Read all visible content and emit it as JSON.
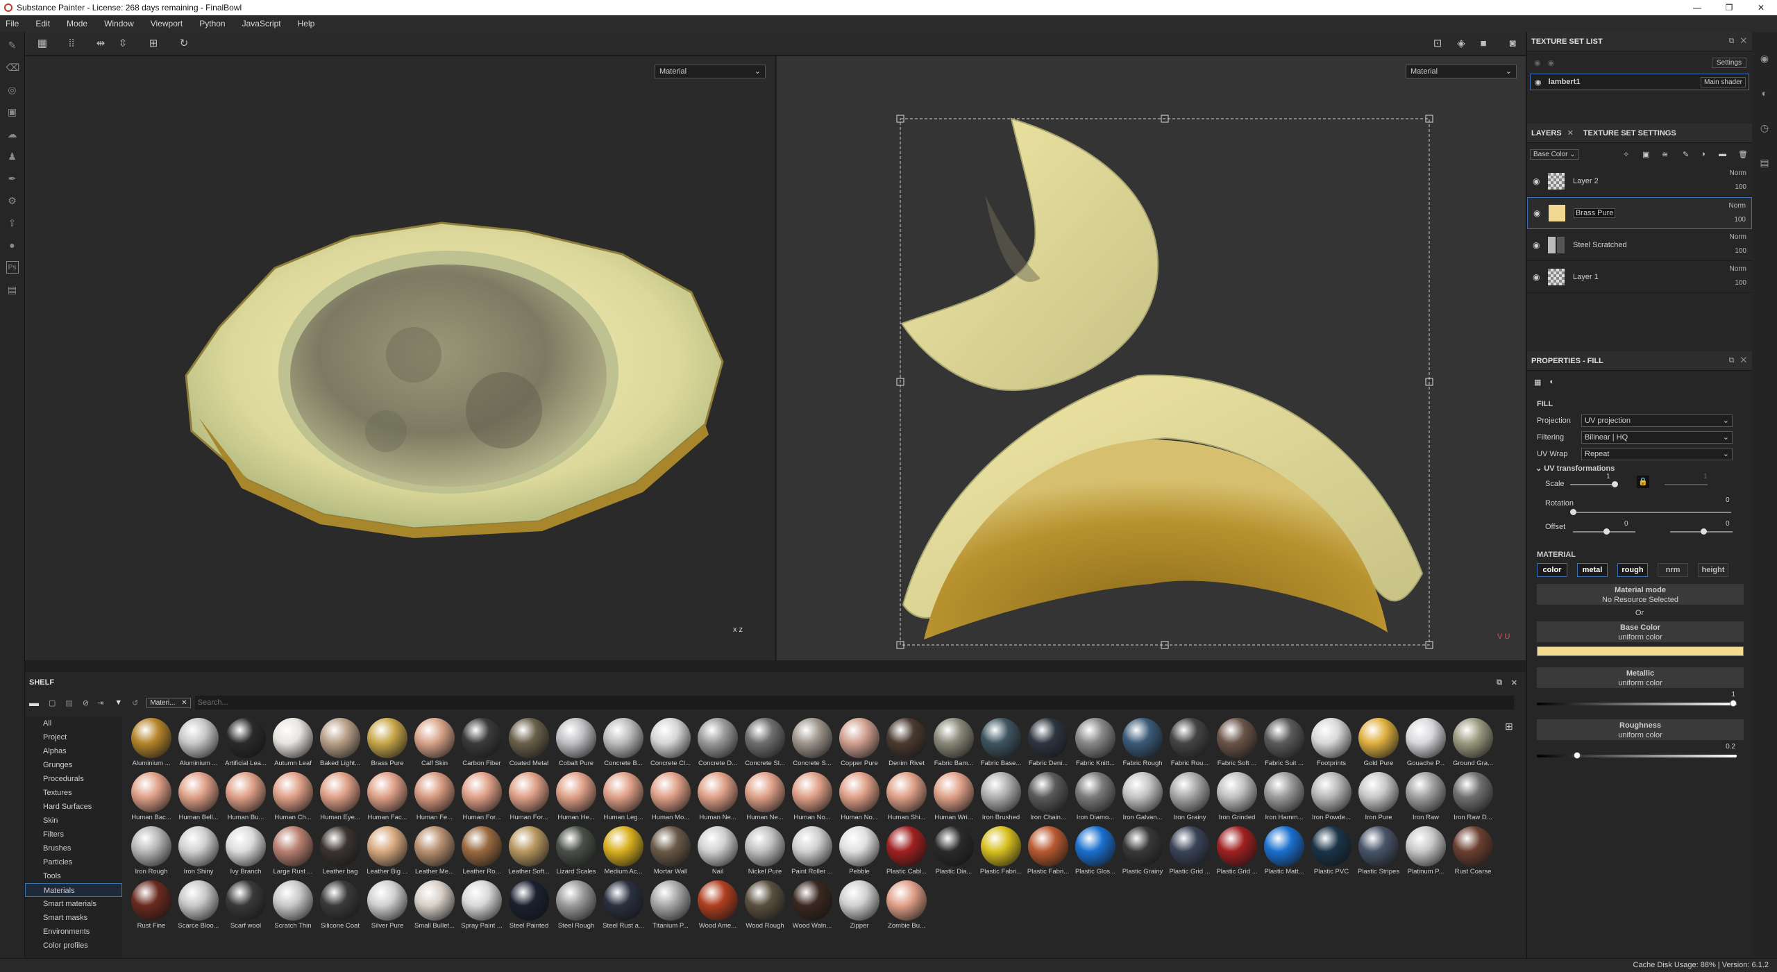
{
  "window": {
    "title": "Substance Painter - License: 268 days remaining - FinalBowl",
    "controls": [
      "—",
      "❐",
      "✕"
    ]
  },
  "menu": [
    "File",
    "Edit",
    "Mode",
    "Window",
    "Viewport",
    "Python",
    "JavaScript",
    "Help"
  ],
  "viewport": {
    "left_mode": "Material",
    "right_mode": "Material",
    "axis_left": "x z",
    "axis_right": "V U"
  },
  "texture_set_list": {
    "title": "TEXTURE SET LIST",
    "settings_label": "Settings",
    "item_name": "lambert1",
    "shader_label": "Main shader"
  },
  "layers_panel": {
    "tab_layers": "LAYERS",
    "tab_settings": "TEXTURE SET SETTINGS",
    "channel": "Base Color",
    "layers": [
      {
        "name": "Layer 2",
        "blend": "Norm",
        "opacity": "100",
        "selected": false,
        "thumb": "checker"
      },
      {
        "name": "Brass Pure",
        "blend": "Norm",
        "opacity": "100",
        "selected": true,
        "thumb": "#f1d891"
      },
      {
        "name": "Steel Scratched",
        "blend": "Norm",
        "opacity": "100",
        "selected": false,
        "thumb": "folder"
      },
      {
        "name": "Layer 1",
        "blend": "Norm",
        "opacity": "100",
        "selected": false,
        "thumb": "checker"
      }
    ]
  },
  "properties": {
    "title": "PROPERTIES - FILL",
    "fill_label": "FILL",
    "projection_label": "Projection",
    "projection_value": "UV projection",
    "filtering_label": "Filtering",
    "filtering_value": "Bilinear | HQ",
    "uvwrap_label": "UV Wrap",
    "uvwrap_value": "Repeat",
    "uv_transform_label": "UV transformations",
    "scale_label": "Scale",
    "scale_value": "1",
    "scale_value2": "1",
    "rotation_label": "Rotation",
    "rotation_value": "0",
    "offset_label": "Offset",
    "offset_value1": "0",
    "offset_value2": "0",
    "material_label": "MATERIAL",
    "material_buttons": [
      {
        "label": "color",
        "on": true
      },
      {
        "label": "metal",
        "on": true
      },
      {
        "label": "rough",
        "on": true
      },
      {
        "label": "nrm",
        "on": false
      },
      {
        "label": "height",
        "on": false
      }
    ],
    "material_mode_title": "Material mode",
    "material_mode_sub": "No Resource Selected",
    "or_label": "Or",
    "base_color_title": "Base Color",
    "base_color_sub": "uniform color",
    "base_color_hex": "#f3dc8f",
    "metallic_title": "Metallic",
    "metallic_sub": "uniform color",
    "metallic_value": "1",
    "metallic_level": 1.0,
    "roughness_title": "Roughness",
    "roughness_sub": "uniform color",
    "roughness_value": "0.2",
    "roughness_level": 0.2
  },
  "shelf": {
    "title": "SHELF",
    "filter_tag": "Materi...",
    "search_placeholder": "Search...",
    "categories": [
      "All",
      "Project",
      "Alphas",
      "Grunges",
      "Procedurals",
      "Textures",
      "Hard Surfaces",
      "Skin",
      "Filters",
      "Brushes",
      "Particles",
      "Tools",
      "Materials",
      "Smart materials",
      "Smart masks",
      "Environments",
      "Color profiles"
    ],
    "selected_category": "Materials",
    "materials": [
      {
        "name": "Aluminium ...",
        "color": "#b5852a"
      },
      {
        "name": "Aluminium ...",
        "color": "#c8c8c8"
      },
      {
        "name": "Artificial Lea...",
        "color": "#2a2a2a"
      },
      {
        "name": "Autumn Leaf",
        "color": "#e8e4e0"
      },
      {
        "name": "Baked Light...",
        "color": "#b8a088"
      },
      {
        "name": "Brass Pure",
        "color": "#c9a84a"
      },
      {
        "name": "Calf Skin",
        "color": "#d8a48a"
      },
      {
        "name": "Carbon Fiber",
        "color": "#3a3a3a"
      },
      {
        "name": "Coated Metal",
        "color": "#6a604a"
      },
      {
        "name": "Cobalt Pure",
        "color": "#c0c0c4"
      },
      {
        "name": "Concrete B...",
        "color": "#bdbdbd"
      },
      {
        "name": "Concrete Cl...",
        "color": "#d6d6d6"
      },
      {
        "name": "Concrete D...",
        "color": "#9a9a9a"
      },
      {
        "name": "Concrete Sl...",
        "color": "#6e6e6e"
      },
      {
        "name": "Concrete S...",
        "color": "#9e968c"
      },
      {
        "name": "Copper Pure",
        "color": "#d0a090"
      },
      {
        "name": "Denim Rivet",
        "color": "#4a3a30"
      },
      {
        "name": "Fabric Bam...",
        "color": "#8a8878"
      },
      {
        "name": "Fabric Base...",
        "color": "#3e5560"
      },
      {
        "name": "Fabric Deni...",
        "color": "#2e3540"
      },
      {
        "name": "Fabric Knitt...",
        "color": "#888888"
      },
      {
        "name": "Fabric Rough",
        "color": "#3a5a78"
      },
      {
        "name": "Fabric Rou...",
        "color": "#444444"
      },
      {
        "name": "Fabric Soft ...",
        "color": "#6a5448"
      },
      {
        "name": "Fabric Suit ...",
        "color": "#5a5a5a"
      },
      {
        "name": "Footprints",
        "color": "#d8d8d8"
      },
      {
        "name": "Gold Pure",
        "color": "#e0b040"
      },
      {
        "name": "Gouache P...",
        "color": "#d8d8dc"
      },
      {
        "name": "Ground Gra...",
        "color": "#9a9a80"
      },
      {
        "name": "Human Bac...",
        "color": "#e0a088"
      },
      {
        "name": "Human Bell...",
        "color": "#e0a088"
      },
      {
        "name": "Human Bu...",
        "color": "#e0a088"
      },
      {
        "name": "Human Ch...",
        "color": "#e0a088"
      },
      {
        "name": "Human Eye...",
        "color": "#e0a088"
      },
      {
        "name": "Human Fac...",
        "color": "#e0a088"
      },
      {
        "name": "Human Fe...",
        "color": "#d89a80"
      },
      {
        "name": "Human For...",
        "color": "#e0a088"
      },
      {
        "name": "Human For...",
        "color": "#e0a088"
      },
      {
        "name": "Human He...",
        "color": "#e0a088"
      },
      {
        "name": "Human Leg...",
        "color": "#e0a088"
      },
      {
        "name": "Human Mo...",
        "color": "#e0a088"
      },
      {
        "name": "Human Ne...",
        "color": "#e0a088"
      },
      {
        "name": "Human Ne...",
        "color": "#e0a088"
      },
      {
        "name": "Human No...",
        "color": "#e0a088"
      },
      {
        "name": "Human No...",
        "color": "#e0a088"
      },
      {
        "name": "Human Shi...",
        "color": "#e0a088"
      },
      {
        "name": "Human Wri...",
        "color": "#e0a088"
      },
      {
        "name": "Iron Brushed",
        "color": "#b0b0b0"
      },
      {
        "name": "Iron Chain...",
        "color": "#5a5a5a"
      },
      {
        "name": "Iron Diamo...",
        "color": "#7a7a7a"
      },
      {
        "name": "Iron Galvan...",
        "color": "#c4c4c4"
      },
      {
        "name": "Iron Grainy",
        "color": "#a8a8a8"
      },
      {
        "name": "Iron Grinded",
        "color": "#c0c0c0"
      },
      {
        "name": "Iron Hamm...",
        "color": "#9a9a9a"
      },
      {
        "name": "Iron Powde...",
        "color": "#b8b8b8"
      },
      {
        "name": "Iron Pure",
        "color": "#c8c8c8"
      },
      {
        "name": "Iron Raw",
        "color": "#a0a0a0"
      },
      {
        "name": "Iron Raw D...",
        "color": "#707070"
      },
      {
        "name": "Iron Rough",
        "color": "#b8b8b8"
      },
      {
        "name": "Iron Shiny",
        "color": "#d0d0d0"
      },
      {
        "name": "Ivy Branch",
        "color": "#dcdcdc"
      },
      {
        "name": "Large Rust ...",
        "color": "#b88070"
      },
      {
        "name": "Leather bag",
        "color": "#3a3430"
      },
      {
        "name": "Leather Big ...",
        "color": "#d8aa80"
      },
      {
        "name": "Leather Me...",
        "color": "#b89070"
      },
      {
        "name": "Leather Ro...",
        "color": "#9a6a40"
      },
      {
        "name": "Leather Soft...",
        "color": "#b89860"
      },
      {
        "name": "Lizard Scales",
        "color": "#4a5048"
      },
      {
        "name": "Medium Ac...",
        "color": "#d8b020"
      },
      {
        "name": "Mortar Wall",
        "color": "#6a5a48"
      },
      {
        "name": "Nail",
        "color": "#d0d0d0"
      },
      {
        "name": "Nickel Pure",
        "color": "#c0c0c0"
      },
      {
        "name": "Paint Roller ...",
        "color": "#d0d0d0"
      },
      {
        "name": "Pebble",
        "color": "#e0e0e0"
      },
      {
        "name": "Plastic Cabl...",
        "color": "#a02020"
      },
      {
        "name": "Plastic Dia...",
        "color": "#2a2a2a"
      },
      {
        "name": "Plastic Fabri...",
        "color": "#d8c020"
      },
      {
        "name": "Plastic Fabri...",
        "color": "#b85a30"
      },
      {
        "name": "Plastic Glos...",
        "color": "#1a70d0"
      },
      {
        "name": "Plastic Grainy",
        "color": "#383838"
      },
      {
        "name": "Plastic Grid ...",
        "color": "#3a4458"
      },
      {
        "name": "Plastic Grid ...",
        "color": "#a02020"
      },
      {
        "name": "Plastic Matt...",
        "color": "#1a70d0"
      },
      {
        "name": "Plastic PVC",
        "color": "#1a3448"
      },
      {
        "name": "Plastic Stripes",
        "color": "#485468"
      },
      {
        "name": "Platinum P...",
        "color": "#c8c8c8"
      },
      {
        "name": "Rust Coarse",
        "color": "#6a4030"
      },
      {
        "name": "Rust Fine",
        "color": "#6a2a20"
      },
      {
        "name": "Scarce Bloo...",
        "color": "#c8c8c8"
      },
      {
        "name": "Scarf wool",
        "color": "#3a3838"
      },
      {
        "name": "Scratch Thin",
        "color": "#c8c8c8"
      },
      {
        "name": "Silicone Coat",
        "color": "#3a3a3a"
      },
      {
        "name": "Silver Pure",
        "color": "#d0d0d0"
      },
      {
        "name": "Small Bullet...",
        "color": "#d8d0c8"
      },
      {
        "name": "Spray Paint ...",
        "color": "#d8d8d8"
      },
      {
        "name": "Steel Painted",
        "color": "#1a2030"
      },
      {
        "name": "Steel Rough",
        "color": "#9a9a9a"
      },
      {
        "name": "Steel Rust a...",
        "color": "#2a3040"
      },
      {
        "name": "Titanium P...",
        "color": "#a8a8a8"
      },
      {
        "name": "Wood Ame...",
        "color": "#b04020"
      },
      {
        "name": "Wood Rough",
        "color": "#5a5040"
      },
      {
        "name": "Wood Waln...",
        "color": "#3a2820"
      },
      {
        "name": "Zipper",
        "color": "#d0d0d0"
      },
      {
        "name": "Zombie Bu...",
        "color": "#e0a088"
      }
    ]
  },
  "status": {
    "text": "Cache Disk Usage:   88% | Version: 6.1.2"
  }
}
